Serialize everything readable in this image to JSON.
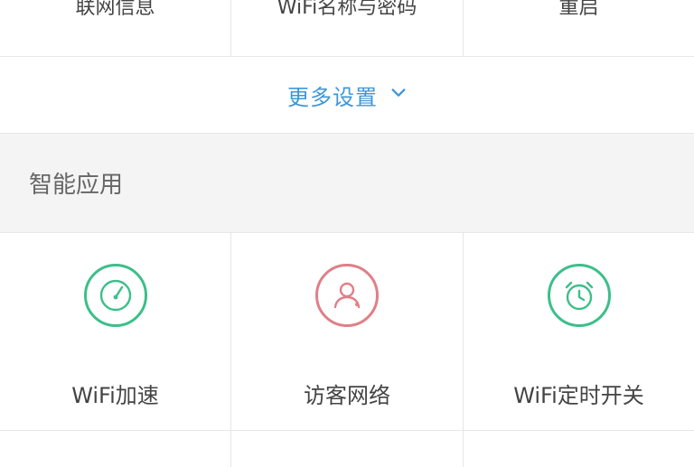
{
  "top_row": {
    "items": [
      {
        "label": "联网信息"
      },
      {
        "label": "WiFi名称与密码"
      },
      {
        "label": "重启"
      }
    ]
  },
  "more_settings": {
    "label": "更多设置"
  },
  "section": {
    "title": "智能应用"
  },
  "apps": [
    {
      "label": "WiFi加速",
      "icon": "speedometer-icon",
      "color": "#3cbf8a"
    },
    {
      "label": "访客网络",
      "icon": "guest-user-icon",
      "color": "#e07f88"
    },
    {
      "label": "WiFi定时开关",
      "icon": "alarm-clock-icon",
      "color": "#3cbf8a"
    }
  ],
  "colors": {
    "accent_blue": "#3f97d6",
    "green": "#3cbf8a",
    "pink": "#e07f88",
    "section_bg": "#f4f4f4",
    "divider": "#e6e6e6"
  }
}
